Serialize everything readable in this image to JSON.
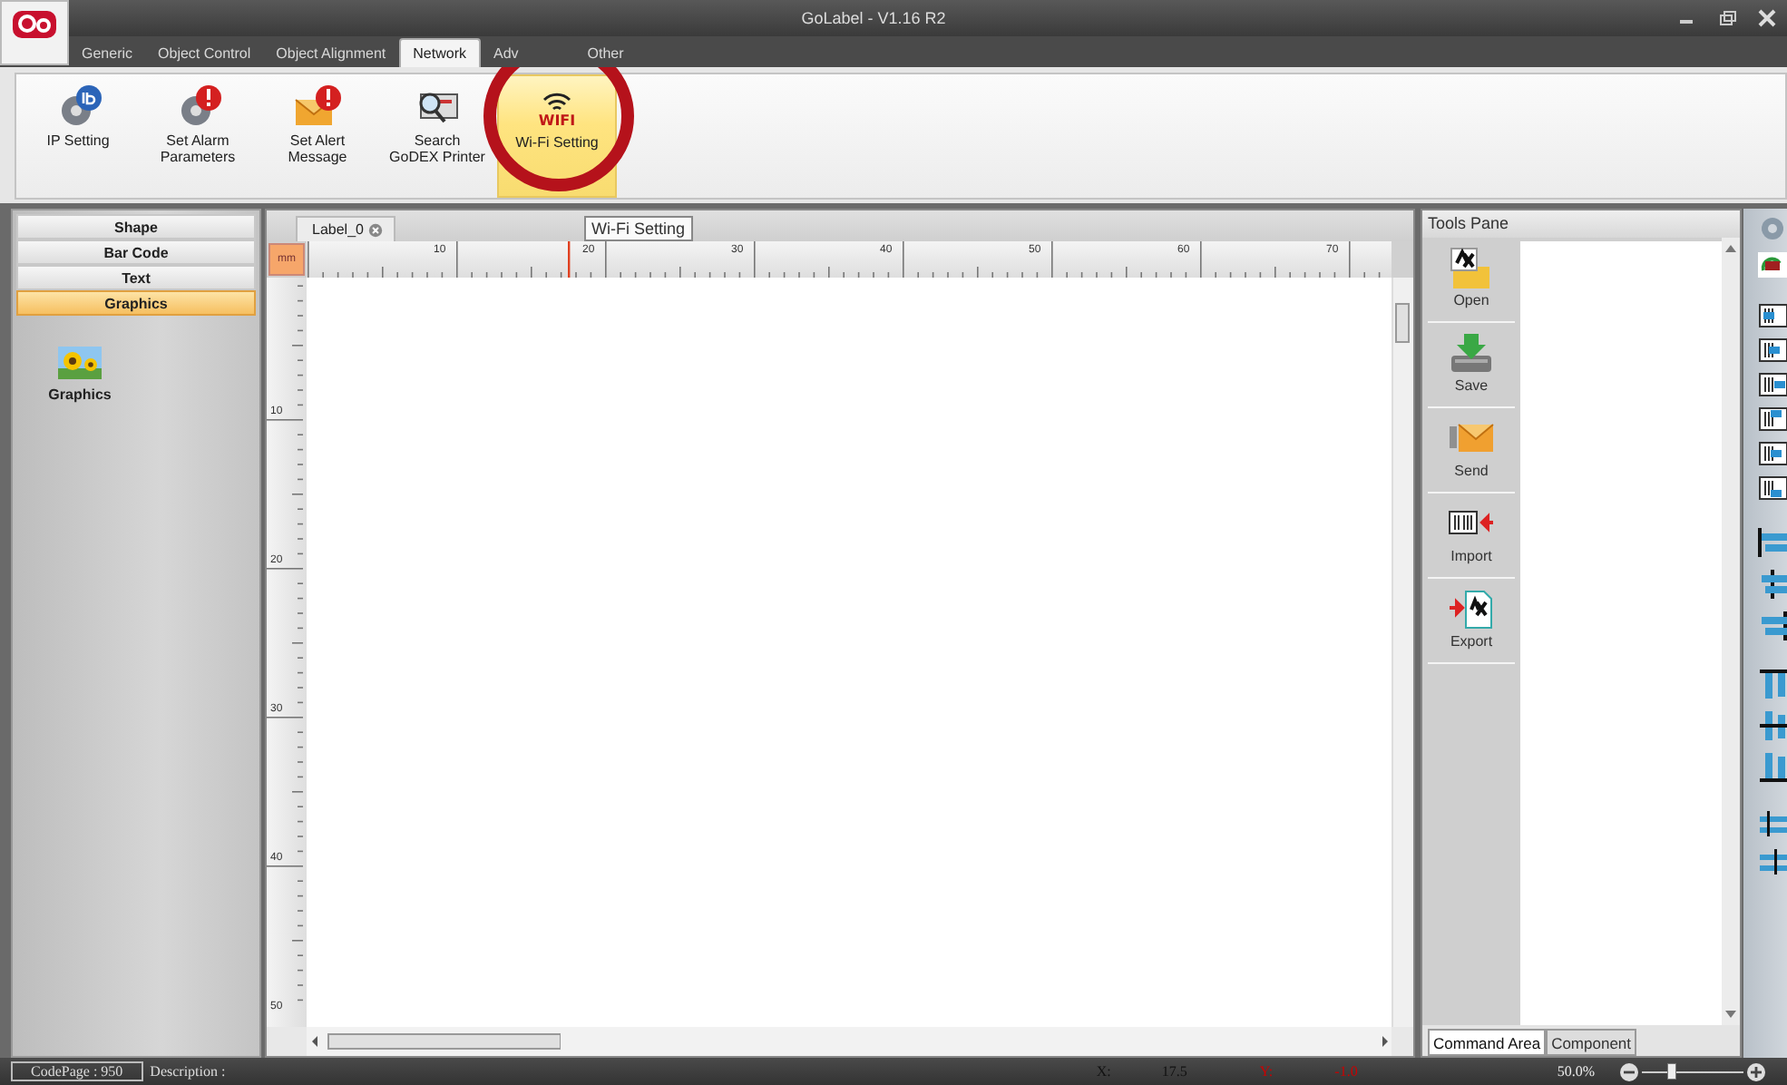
{
  "window": {
    "title": "GoLabel - V1.16 R2"
  },
  "tabs": [
    {
      "label": "Generic",
      "selected": false
    },
    {
      "label": "Object Control",
      "selected": false
    },
    {
      "label": "Object Alignment",
      "selected": false
    },
    {
      "label": "Network",
      "selected": true
    },
    {
      "label": "Adv",
      "selected": false
    },
    {
      "label": "Other",
      "selected": false
    }
  ],
  "ribbon_buttons": [
    {
      "label": "IP Setting",
      "kind": "ip",
      "selected": false
    },
    {
      "label": "Set Alarm Parameters",
      "kind": "alarm",
      "selected": false
    },
    {
      "label": "Set Alert Message",
      "kind": "alert",
      "selected": false
    },
    {
      "label": "Search GoDEX Printer",
      "kind": "search",
      "selected": false
    },
    {
      "label": "Wi-Fi Setting",
      "kind": "wifi",
      "selected": true,
      "icon_text": "WIFI"
    }
  ],
  "tooltip": "Wi-Fi Setting",
  "categories": [
    {
      "label": "Shape",
      "selected": false
    },
    {
      "label": "Bar Code",
      "selected": false
    },
    {
      "label": "Text",
      "selected": false
    },
    {
      "label": "Graphics",
      "selected": true
    }
  ],
  "palette_items": [
    {
      "label": "Graphics"
    }
  ],
  "document_tabs": [
    {
      "label": "Label_0",
      "selected": true
    }
  ],
  "ruler": {
    "unit": "mm",
    "horizontal": [
      "10",
      "20",
      "30",
      "40",
      "50",
      "60",
      "70"
    ],
    "vertical": [
      "10",
      "20",
      "30",
      "40",
      "50"
    ]
  },
  "tools_pane": {
    "title": "Tools Pane",
    "tools": [
      {
        "label": "Open",
        "kind": "open"
      },
      {
        "label": "Save",
        "kind": "save"
      },
      {
        "label": "Send",
        "kind": "send"
      },
      {
        "label": "Import",
        "kind": "import"
      },
      {
        "label": "Export",
        "kind": "export"
      }
    ],
    "bottom_tabs": [
      {
        "label": "Command Area",
        "selected": true
      },
      {
        "label": "Component",
        "selected": false
      }
    ]
  },
  "status_bar": {
    "codepage": "CodePage : 950",
    "description": "Description :",
    "x_label": "X:",
    "x_value": "17.5",
    "y_label": "Y:",
    "y_value": "-1.0",
    "zoom": "50.0%",
    "zoom_slider": {
      "level": 0.3
    }
  }
}
